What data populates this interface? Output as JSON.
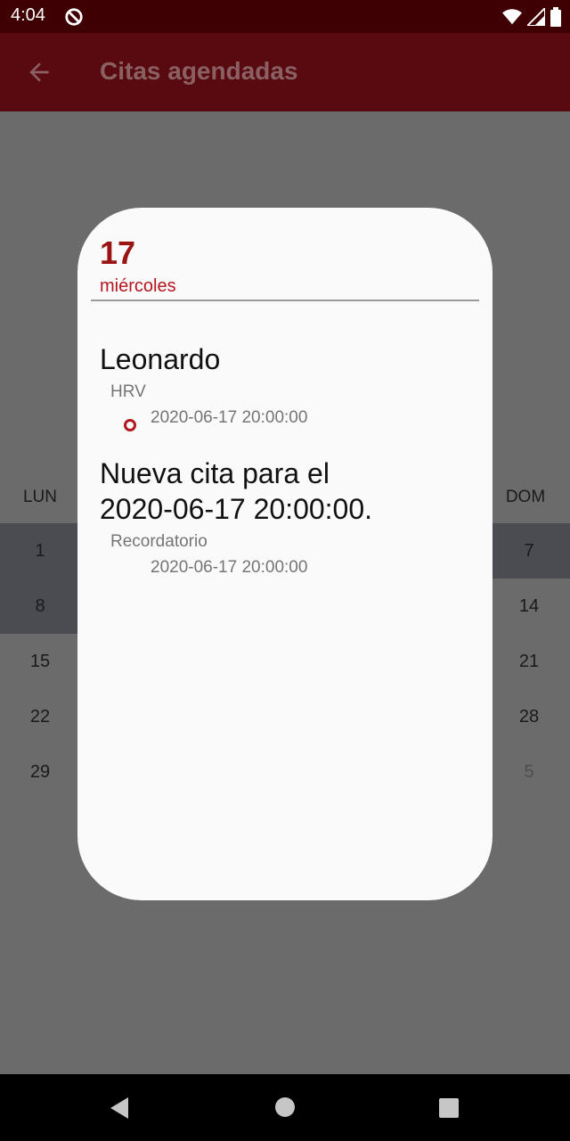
{
  "status_bar": {
    "time": "4:04"
  },
  "app_bar": {
    "title": "Citas agendadas"
  },
  "calendar": {
    "headers": {
      "mon": "LUN",
      "sun": "DOM"
    },
    "weeks": [
      {
        "mon": "1",
        "sun": "7"
      },
      {
        "mon": "8",
        "sun": "14"
      },
      {
        "mon": "15",
        "sun": "21"
      },
      {
        "mon": "22",
        "sun": "28"
      },
      {
        "mon": "29",
        "sun": "5"
      }
    ]
  },
  "dialog": {
    "day_number": "17",
    "day_name": "miércoles",
    "events": [
      {
        "title": "Leonardo",
        "type": "HRV",
        "datetime": "2020-06-17 20:00:00"
      },
      {
        "title_line1": "Nueva cita para el",
        "title_line2": "2020-06-17 20:00:00.",
        "type": "Recordatorio",
        "datetime": "2020-06-17 20:00:00"
      }
    ]
  },
  "colors": {
    "accent": "#b3161e",
    "app_bar": "#580a10",
    "status_bar": "#3f0004"
  }
}
